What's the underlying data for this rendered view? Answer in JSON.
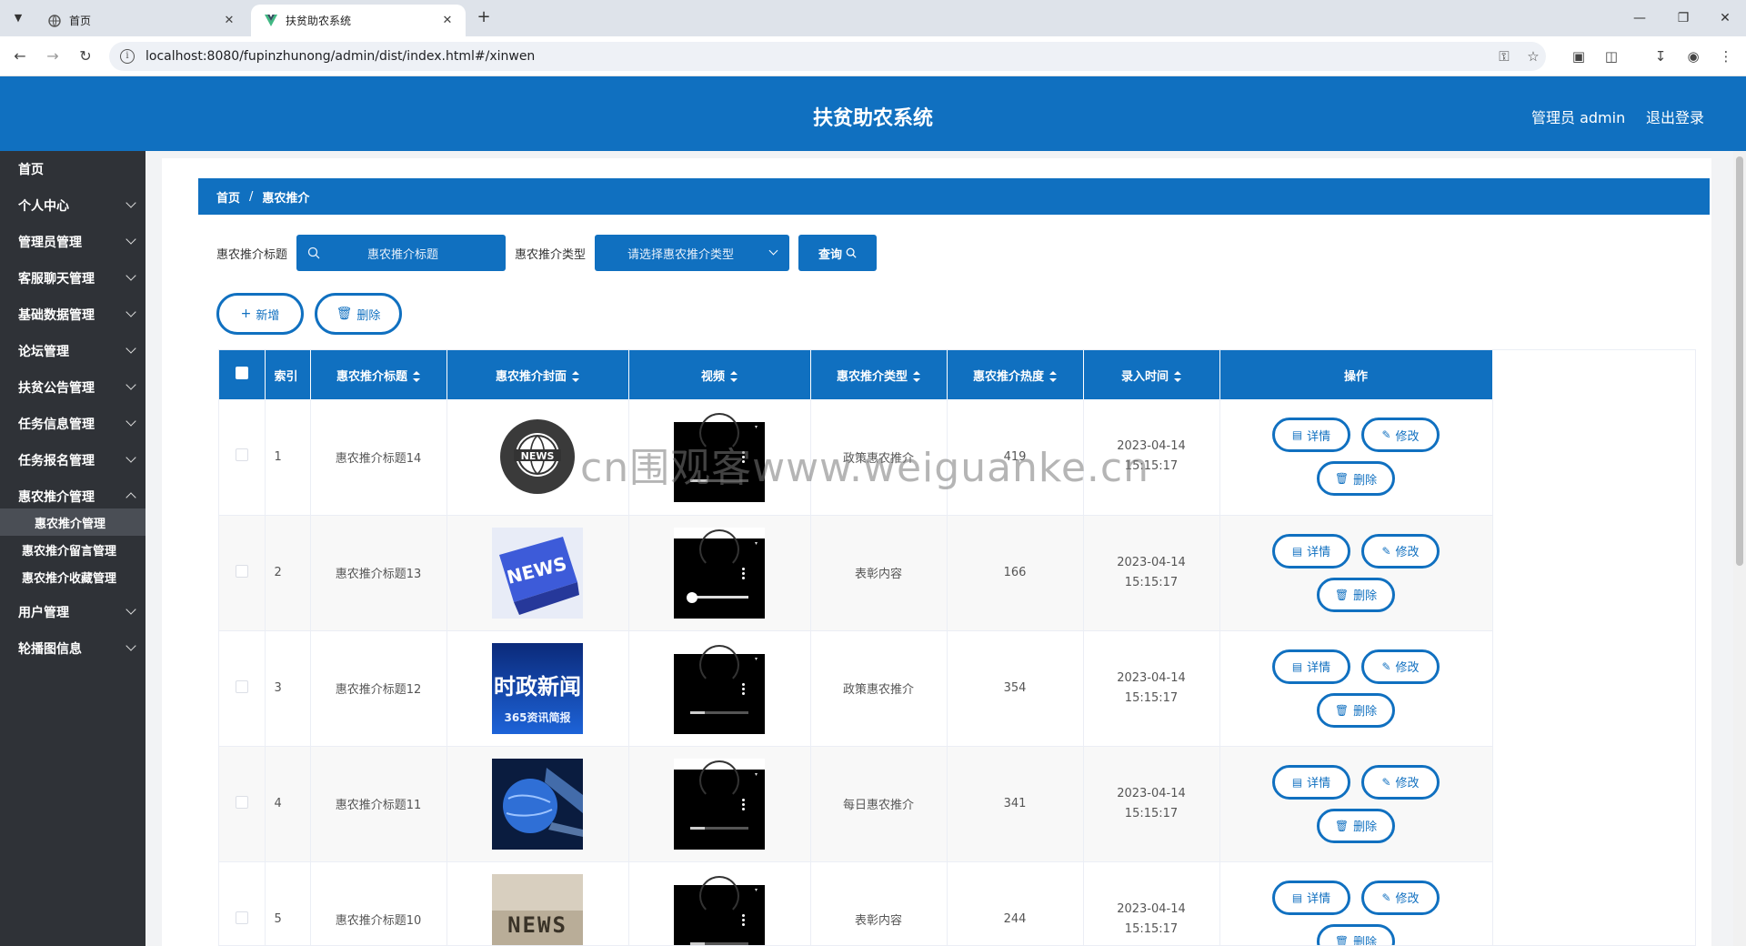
{
  "browser": {
    "tabs": [
      {
        "label": "首页",
        "icon": "globe-icon"
      },
      {
        "label": "扶贫助农系统",
        "icon": "vue-logo-icon"
      }
    ],
    "url": "localhost:8080/fupinzhunong/admin/dist/index.html#/xinwen"
  },
  "header": {
    "title": "扶贫助农系统",
    "admin": "管理员 admin",
    "logout": "退出登录"
  },
  "sidebar": {
    "items": [
      {
        "label": "首页"
      },
      {
        "label": "个人中心"
      },
      {
        "label": "管理员管理"
      },
      {
        "label": "客服聊天管理"
      },
      {
        "label": "基础数据管理"
      },
      {
        "label": "论坛管理"
      },
      {
        "label": "扶贫公告管理"
      },
      {
        "label": "任务信息管理"
      },
      {
        "label": "任务报名管理"
      },
      {
        "label": "惠农推介管理"
      },
      {
        "label": "用户管理"
      },
      {
        "label": "轮播图信息"
      }
    ],
    "subitems": [
      {
        "label": "惠农推介管理"
      },
      {
        "label": "惠农推介留言管理"
      },
      {
        "label": "惠农推介收藏管理"
      }
    ]
  },
  "breadcrumb": {
    "home": "首页",
    "current": "惠农推介"
  },
  "search": {
    "title_label": "惠农推介标题",
    "title_placeholder": "惠农推介标题",
    "type_label": "惠农推介类型",
    "type_placeholder": "请选择惠农推介类型",
    "query": "查询"
  },
  "actions": {
    "add": "新增",
    "delete": "删除"
  },
  "table": {
    "headers": [
      "索引",
      "惠农推介标题",
      "惠农推介封面",
      "视频",
      "惠农推介类型",
      "惠农推介热度",
      "录入时间",
      "操作"
    ],
    "op_labels": {
      "detail": "详情",
      "edit": "修改",
      "delete": "删除"
    },
    "rows": [
      {
        "index": "1",
        "title": "惠农推介标题14",
        "type": "政策惠农推介",
        "heat": "419",
        "time": "2023-04-14 15:15:17"
      },
      {
        "index": "2",
        "title": "惠农推介标题13",
        "type": "表彰内容",
        "heat": "166",
        "time": "2023-04-14 15:15:17"
      },
      {
        "index": "3",
        "title": "惠农推介标题12",
        "type": "政策惠农推介",
        "heat": "354",
        "time": "2023-04-14 15:15:17"
      },
      {
        "index": "4",
        "title": "惠农推介标题11",
        "type": "每日惠农推介",
        "heat": "341",
        "time": "2023-04-14 15:15:17"
      },
      {
        "index": "5",
        "title": "惠农推介标题10",
        "type": "表彰内容",
        "heat": "244",
        "time": "2023-04-14 15:15:17"
      }
    ],
    "cover_texts": [
      "NEWS",
      "NEWS",
      "时政新闻",
      "",
      "NEWS"
    ],
    "cover_subtext": "365资讯简报"
  },
  "watermark": "cn围观客www.weiguanke.cn",
  "colors": {
    "primary": "#1070c0",
    "sidebar": "#2f3237",
    "content_bg": "#f2f3f5"
  }
}
